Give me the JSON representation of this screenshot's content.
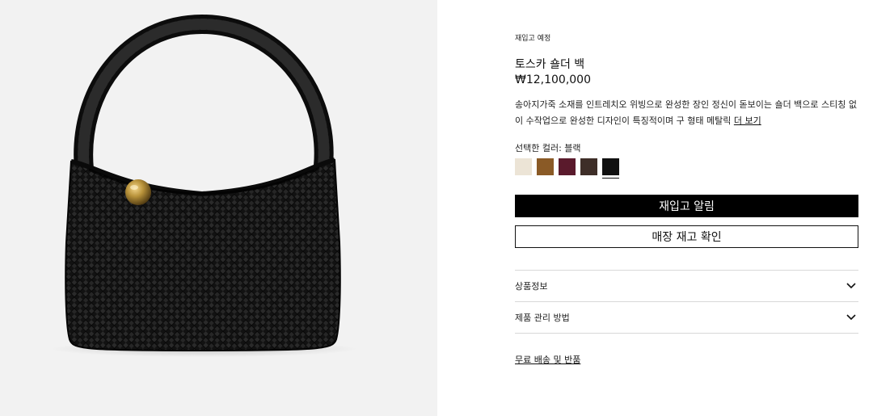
{
  "product": {
    "status": "재입고 예정",
    "title": "토스카 숄더 백",
    "price": "₩12,100,000",
    "description": "송아지가죽 소재를 인트레치오 위빙으로 완성한 장인 정신이 돋보이는 숄더 백으로 스티칭 없이 수작업으로 완성한 디자인이 특징적이며 구 형태 메탈릭",
    "more_label": "더 보기",
    "selected_color_label": "선택한 컬러: 블랙"
  },
  "swatches": [
    {
      "name": "cream",
      "color": "#ece4d6"
    },
    {
      "name": "tan",
      "color": "#8a5a26"
    },
    {
      "name": "burgundy",
      "color": "#5a1a2c"
    },
    {
      "name": "dark-brown",
      "color": "#3e2e28"
    },
    {
      "name": "black",
      "color": "#111111",
      "selected": true
    }
  ],
  "actions": {
    "restock_alert": "재입고 알림",
    "store_stock": "매장 재고 확인"
  },
  "accordion": [
    {
      "label": "상품정보",
      "icon": "chevron-down-icon"
    },
    {
      "label": "제품 관리 방법",
      "icon": "chevron-down-icon"
    }
  ],
  "shipping_link": "무료 배송 및 반품",
  "image": {
    "bag_color": "#141414",
    "clasp_color": "#b8923a",
    "background": "#f2f2f2"
  }
}
